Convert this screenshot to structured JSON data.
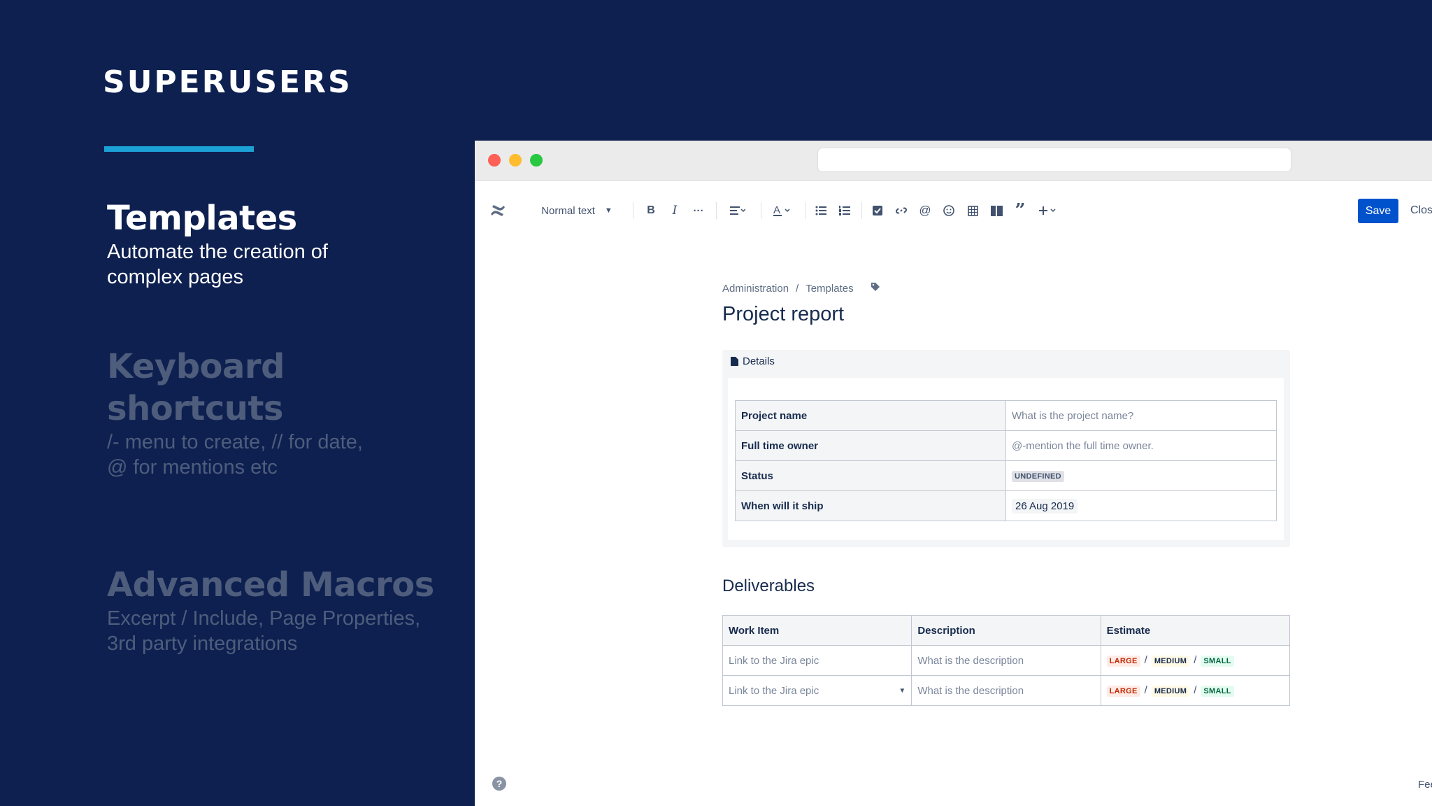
{
  "slide": {
    "brand": "SUPERUSERS",
    "sections": [
      {
        "title": "Templates",
        "subtitle_line1": "Automate the creation of",
        "subtitle_line2": "complex pages"
      },
      {
        "title_line1": "Keyboard",
        "title_line2": "shortcuts",
        "subtitle_line1": "/- menu to create, // for date,",
        "subtitle_line2": "@ for mentions etc"
      },
      {
        "title": "Advanced Macros",
        "subtitle_line1": "Excerpt / Include, Page Properties,",
        "subtitle_line2": "3rd party integrations"
      }
    ],
    "accent_color": "#1ca1d6",
    "background_color": "#0e2050"
  },
  "editor": {
    "toolbar": {
      "text_style": "Normal text",
      "icons": [
        "confluence-logo-icon",
        "bold-icon",
        "italic-icon",
        "more-formatting-icon",
        "align-icon",
        "text-color-icon",
        "bullet-list-icon",
        "numbered-list-icon",
        "action-item-icon",
        "link-icon",
        "mention-icon",
        "emoji-icon",
        "table-icon",
        "layouts-icon",
        "quote-icon",
        "insert-icon"
      ],
      "save_label": "Save",
      "close_label": "Close"
    },
    "breadcrumb": [
      "Administration",
      "Templates"
    ],
    "page_title": "Project report",
    "details": {
      "label": "Details",
      "rows": [
        {
          "key": "Project name",
          "value": "What is the project name?"
        },
        {
          "key": "Full time owner",
          "value": "@-mention the full time owner."
        },
        {
          "key": "Status",
          "value": "UNDEFINED"
        },
        {
          "key": "When will it ship",
          "value": "26 Aug 2019"
        }
      ]
    },
    "deliverables": {
      "heading": "Deliverables",
      "columns": [
        "Work Item",
        "Description",
        "Estimate"
      ],
      "rows": [
        {
          "work_item": "Link to the Jira epic",
          "description": "What is the description",
          "estimates": [
            "LARGE",
            "MEDIUM",
            "SMALL"
          ]
        },
        {
          "work_item": "Link to the Jira epic",
          "description": "What is the description",
          "estimates": [
            "LARGE",
            "MEDIUM",
            "SMALL"
          ]
        }
      ],
      "separator": "/"
    },
    "feedback_label": "Feedback",
    "save_color": "#0052cc"
  }
}
